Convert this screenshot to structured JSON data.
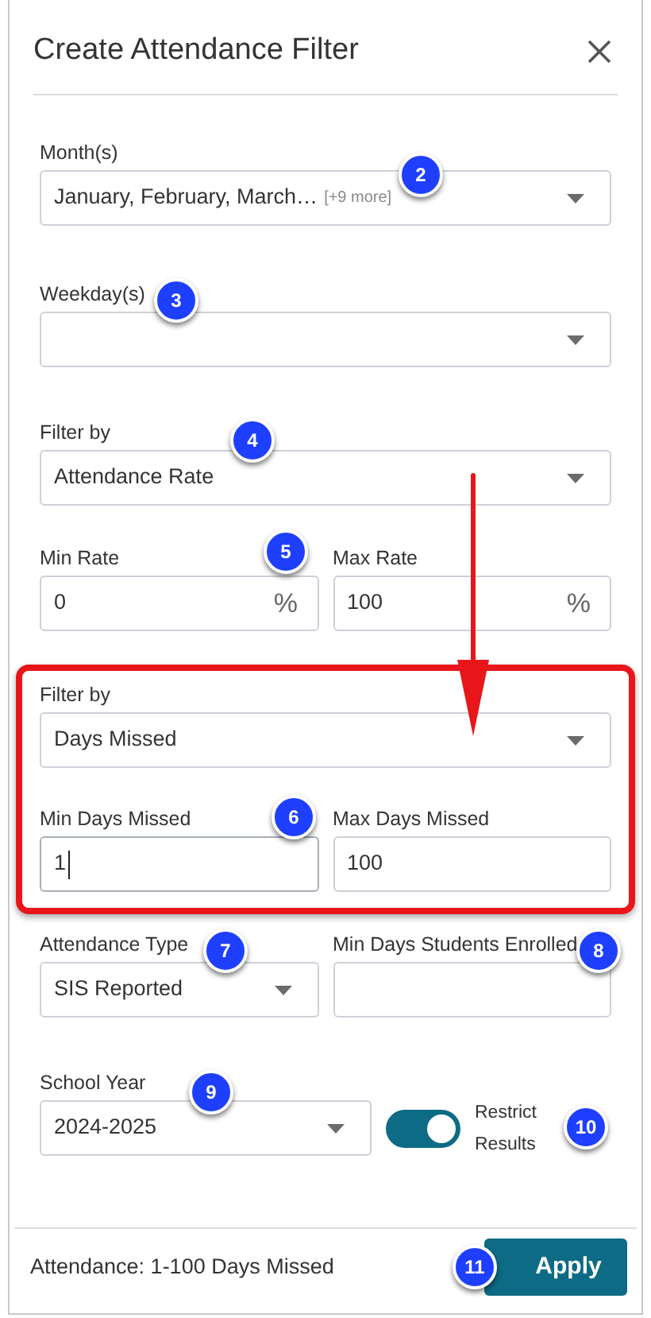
{
  "dialog": {
    "title": "Create Attendance Filter"
  },
  "months": {
    "label": "Month(s)",
    "value": "January, February, March…",
    "extra": "[+9 more]"
  },
  "weekdays": {
    "label": "Weekday(s)"
  },
  "filter_1": {
    "label": "Filter by",
    "value": "Attendance Rate"
  },
  "rate": [
    {
      "label": "Min Rate",
      "value": "0",
      "suffix": "%",
      "focused": false
    },
    {
      "label": "Max Rate",
      "value": "100",
      "suffix": "%",
      "focused": false
    }
  ],
  "filter_2": {
    "label": "Filter by",
    "value": "Days Missed"
  },
  "days_missed": [
    {
      "label": "Min Days Missed",
      "value": "1",
      "focused": true
    },
    {
      "label": "Max Days Missed",
      "value": "100",
      "focused": false
    }
  ],
  "attendance_type": {
    "label": "Attendance Type",
    "value": "SIS Reported"
  },
  "min_days_enrolled": {
    "label": "Min Days Students Enrolled"
  },
  "school_year": {
    "label": "School Year",
    "value": "2024-2025"
  },
  "restrict": {
    "label": "Restrict Results",
    "on": true
  },
  "footer": {
    "summary": "Attendance: 1-100 Days Missed",
    "button": "Apply"
  },
  "callouts": [
    "2",
    "3",
    "4",
    "5",
    "6",
    "7",
    "8",
    "9",
    "10",
    "11"
  ]
}
